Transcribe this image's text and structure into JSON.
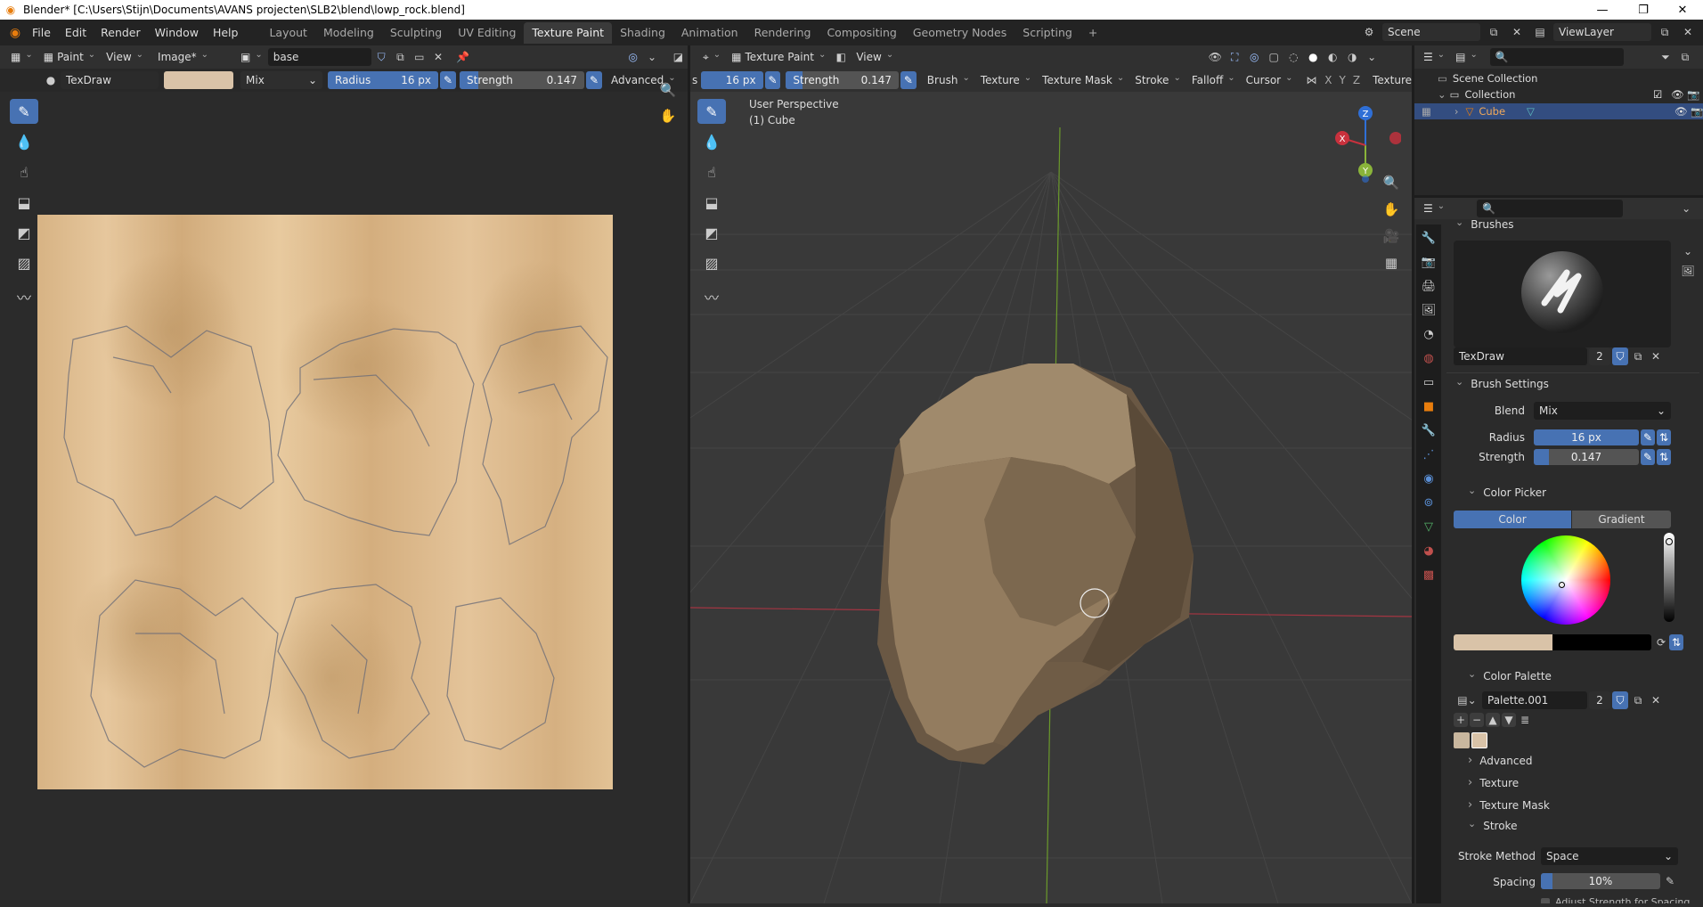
{
  "titlebar": {
    "text": "Blender* [C:\\Users\\Stijn\\Documents\\AVANS projecten\\SLB2\\blend\\lowp_rock.blend]"
  },
  "menu": [
    "File",
    "Edit",
    "Render",
    "Window",
    "Help"
  ],
  "workspaces": [
    "Layout",
    "Modeling",
    "Sculpting",
    "UV Editing",
    "Texture Paint",
    "Shading",
    "Animation",
    "Rendering",
    "Compositing",
    "Geometry Nodes",
    "Scripting",
    "+"
  ],
  "active_workspace": "Texture Paint",
  "scene": {
    "name": "Scene",
    "viewlayer": "ViewLayer"
  },
  "image_editor": {
    "mode": "Paint",
    "menus": [
      "View",
      "Image*"
    ],
    "image_name": "base",
    "tool": {
      "brush": "TexDraw",
      "blend": "Mix",
      "radius_label": "Radius",
      "radius": "16 px",
      "strength_label": "Strength",
      "strength": "0.147",
      "strength_fraction": 0.147,
      "advanced": "Advanced"
    },
    "brush_color": "#d9c3a8",
    "texture_color": "#d9b386"
  },
  "viewport": {
    "mode": "Texture Paint",
    "menu": "View",
    "perspective": "User Perspective",
    "object": "(1) Cube",
    "tool": {
      "radius_tail": "s",
      "radius": "16 px",
      "strength_label": "Strength",
      "strength": "0.147",
      "menus": [
        "Brush",
        "Texture",
        "Texture Mask",
        "Stroke",
        "Falloff",
        "Cursor"
      ],
      "axes": [
        "X",
        "Y",
        "Z"
      ],
      "texture_tab": "Texture"
    },
    "gizmo": {
      "z": "Z",
      "y": "Y",
      "x": "X"
    },
    "rock_color": "#8a7458"
  },
  "outliner": {
    "search_placeholder": "",
    "rows": [
      {
        "label": "Scene Collection"
      },
      {
        "label": "Collection"
      },
      {
        "label": "Cube"
      }
    ]
  },
  "properties": {
    "search_placeholder": "",
    "brushes_title": "Brushes",
    "brush_name": "TexDraw",
    "brush_users": "2",
    "brush_settings_title": "Brush Settings",
    "blend_label": "Blend",
    "blend_value": "Mix",
    "radius_label": "Radius",
    "radius_value": "16 px",
    "strength_label": "Strength",
    "strength_value": "0.147",
    "strength_fraction": 0.147,
    "color_picker_title": "Color Picker",
    "color_tab": "Color",
    "gradient_tab": "Gradient",
    "color_palette_title": "Color Palette",
    "palette_name": "Palette.001",
    "palette_users": "2",
    "palette_swatches": [
      "#c9b79e",
      "#d9c3a8"
    ],
    "subpanels": [
      "Advanced",
      "Texture",
      "Texture Mask"
    ],
    "stroke_title": "Stroke",
    "stroke_method_label": "Stroke Method",
    "stroke_method_value": "Space",
    "spacing_label": "Spacing",
    "spacing_value": "10%",
    "spacing_fraction": 0.1,
    "cut_off_label": "Adjust Strength for Spacing"
  },
  "colors": {
    "accent": "#4772b3",
    "orange": "#e87d0d",
    "red_axis": "#c9313d",
    "green_axis": "#6b9a2b"
  }
}
